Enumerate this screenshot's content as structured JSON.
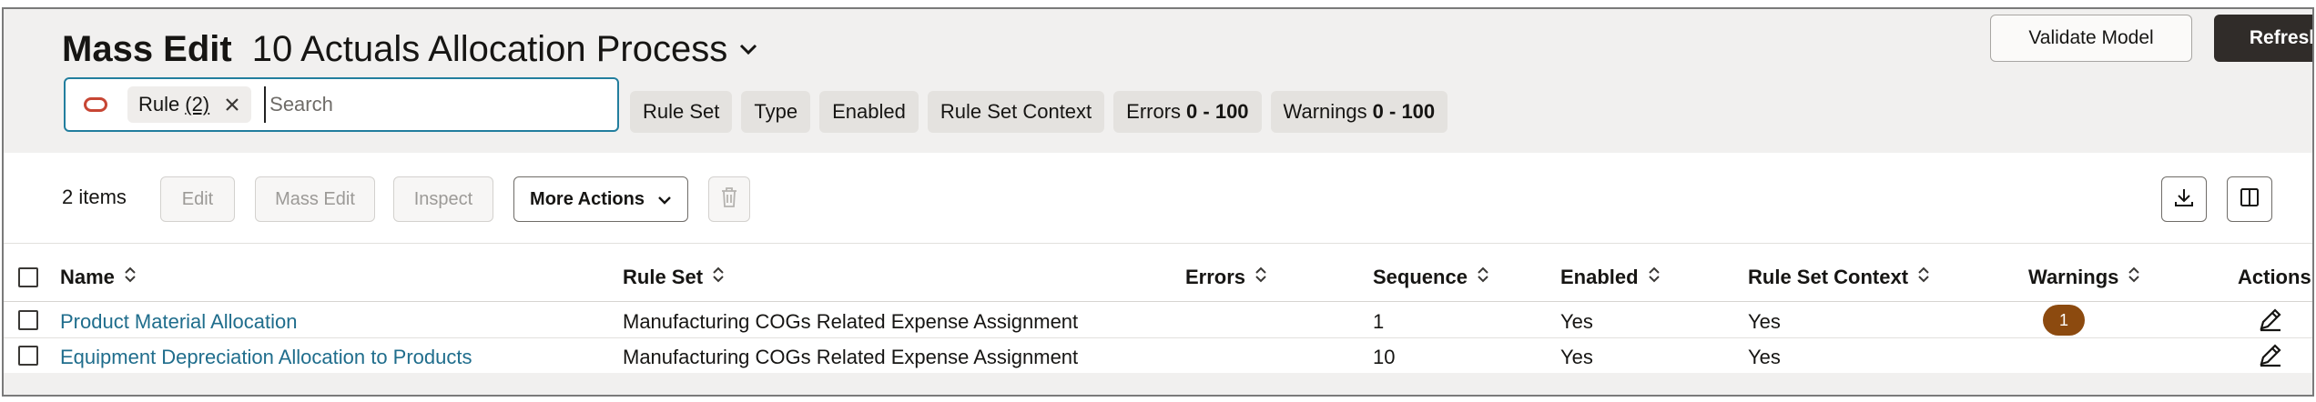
{
  "header": {
    "title": "Mass Edit",
    "process": "10 Actuals Allocation Process",
    "validate_label": "Validate Model",
    "refresh_label": "Refresh"
  },
  "search": {
    "chip_label": "Rule",
    "chip_count": "(2)",
    "placeholder": "Search"
  },
  "filters": [
    {
      "label": "Rule Set",
      "range": ""
    },
    {
      "label": "Type",
      "range": ""
    },
    {
      "label": "Enabled",
      "range": ""
    },
    {
      "label": "Rule Set Context",
      "range": ""
    },
    {
      "label": "Errors",
      "range": "0 - 100"
    },
    {
      "label": "Warnings",
      "range": "0 - 100"
    }
  ],
  "toolbar": {
    "items_count": "2 items",
    "edit_label": "Edit",
    "mass_edit_label": "Mass Edit",
    "inspect_label": "Inspect",
    "more_actions_label": "More Actions"
  },
  "table": {
    "columns": [
      "Name",
      "Rule Set",
      "Errors",
      "Sequence",
      "Enabled",
      "Rule Set Context",
      "Warnings",
      "Actions"
    ],
    "rows": [
      {
        "name": "Product Material Allocation",
        "rule_set": "Manufacturing COGs Related Expense Assignment",
        "errors": "",
        "sequence": "1",
        "enabled": "Yes",
        "context": "Yes",
        "warnings": "1"
      },
      {
        "name": "Equipment Depreciation Allocation to Products",
        "rule_set": "Manufacturing COGs Related Expense Assignment",
        "errors": "",
        "sequence": "10",
        "enabled": "Yes",
        "context": "Yes",
        "warnings": ""
      }
    ]
  },
  "colors": {
    "accent": "#227e9e",
    "link": "#1f6d8c",
    "brand": "#c74634",
    "warning_badge": "#8c4a0f",
    "primary_button": "#302c29"
  }
}
